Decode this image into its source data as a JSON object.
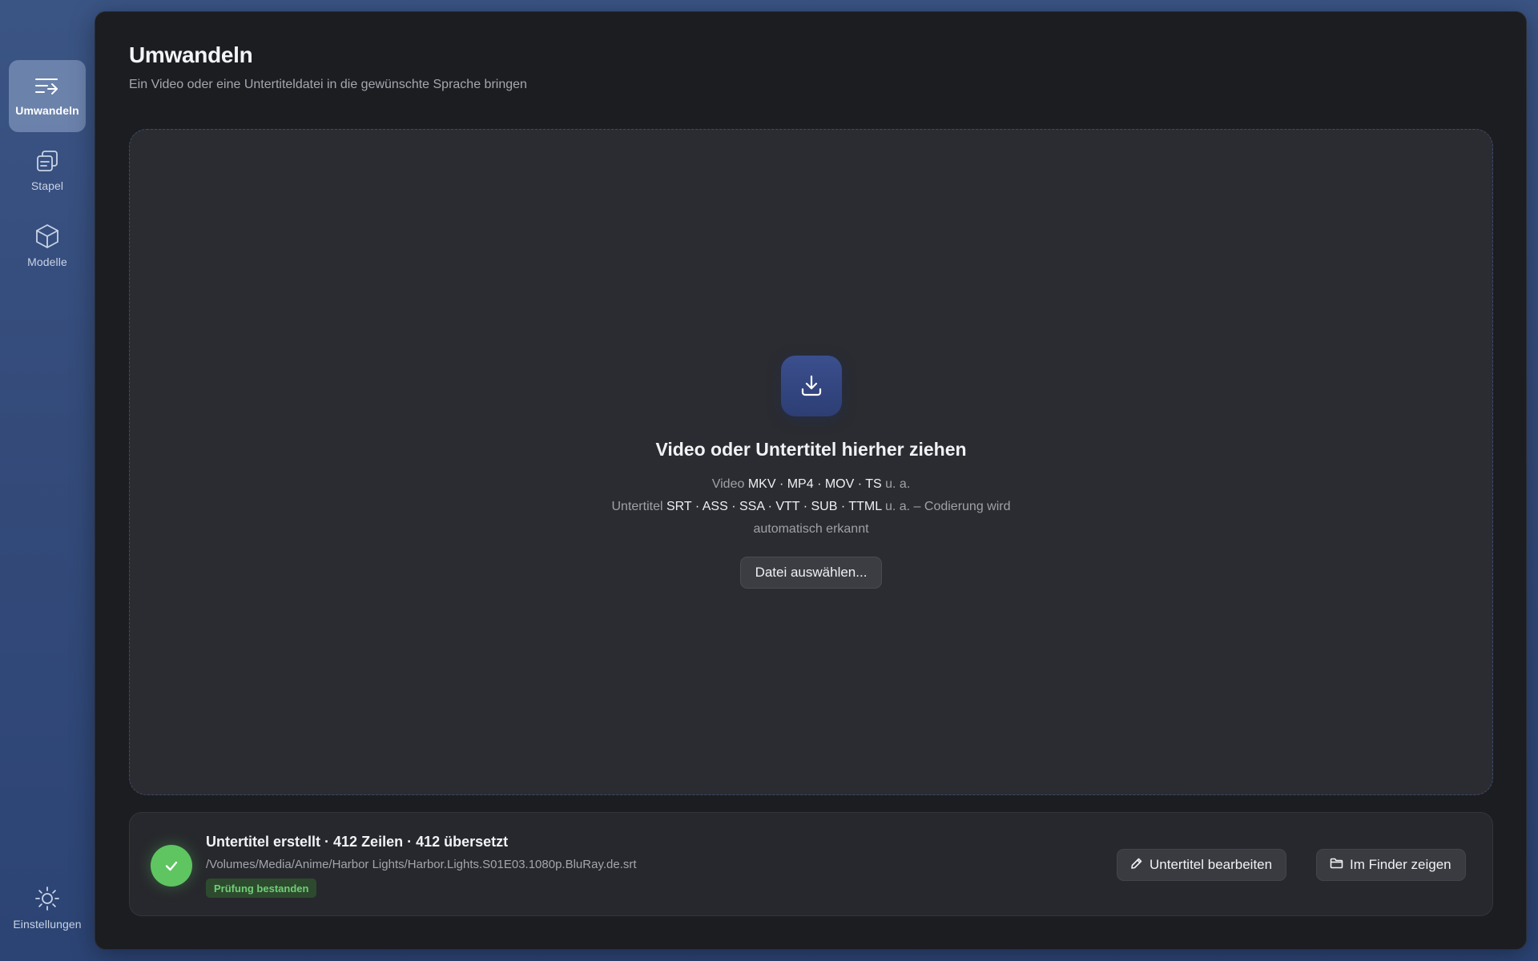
{
  "sidebar": {
    "items": [
      {
        "label": "Umwandeln",
        "icon": "convert-icon",
        "active": true
      },
      {
        "label": "Stapel",
        "icon": "stack-icon",
        "active": false
      },
      {
        "label": "Modelle",
        "icon": "cube-icon",
        "active": false
      }
    ],
    "settings": {
      "label": "Einstellungen",
      "icon": "sun-gear-icon"
    }
  },
  "header": {
    "title": "Umwandeln",
    "subtitle": "Ein Video oder eine Untertiteldatei in die gewünschte Sprache bringen"
  },
  "dropzone": {
    "icon": "download-tray-icon",
    "title": "Video oder Untertitel hierher ziehen",
    "video_prefix": "Video",
    "video_formats": [
      "MKV",
      "MP4",
      "MOV",
      "TS"
    ],
    "video_suffix": "u. a.",
    "subtitle_prefix": "Untertitel",
    "subtitle_formats": [
      "SRT",
      "ASS",
      "SSA",
      "VTT",
      "SUB",
      "TTML"
    ],
    "subtitle_suffix": "u. a. – Codierung wird automatisch erkannt",
    "separator": " · ",
    "choose_button": "Datei auswählen..."
  },
  "result": {
    "status_icon": "check-icon",
    "title": "Untertitel erstellt · 412 Zeilen · 412 übersetzt",
    "path": "/Volumes/Media/Anime/Harbor Lights/Harbor.Lights.S01E03.1080p.BluRay.de.srt",
    "badge": "Prüfung bestanden",
    "edit_button": "Untertitel bearbeiten",
    "finder_button": "Im Finder zeigen"
  },
  "colors": {
    "accent": "#3b4f8e",
    "success": "#5ec561",
    "panel": "#1c1d21",
    "dropzone": "#2b2c31"
  }
}
